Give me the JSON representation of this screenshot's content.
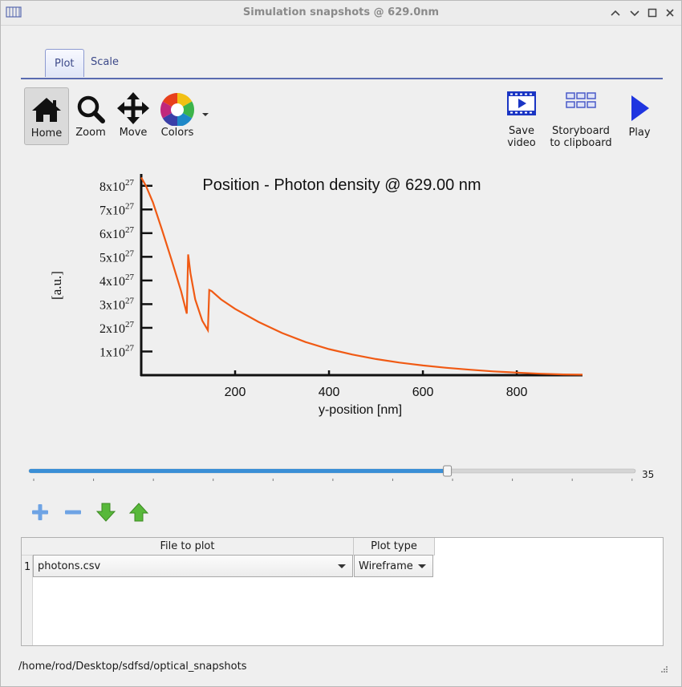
{
  "window": {
    "title": "Simulation snapshots @ 629.0nm"
  },
  "tabs": [
    {
      "label": "Plot",
      "active": true
    },
    {
      "label": "Scale",
      "active": false
    }
  ],
  "toolbar": {
    "home": "Home",
    "zoom": "Zoom",
    "move": "Move",
    "colors": "Colors",
    "save_video": [
      "Save",
      "video"
    ],
    "storyboard": [
      "Storyboard",
      "to clipboard"
    ],
    "play": "Play"
  },
  "colors": {
    "accent": "#5a6bb0",
    "curve": "#f05a14",
    "slider": "#3a8fd6"
  },
  "chart_data": {
    "type": "line",
    "title": "Position - Photon density @ 629.00 nm",
    "xlabel": "y-position [nm]",
    "ylabel": "[a.u.]",
    "xlim": [
      0,
      940
    ],
    "ylim": [
      0,
      8.5e+27
    ],
    "xticks": [
      200,
      400,
      600,
      800
    ],
    "yticks": [
      {
        "value": 1e+27,
        "mant": "1",
        "exp": "27"
      },
      {
        "value": 2e+27,
        "mant": "2",
        "exp": "27"
      },
      {
        "value": 3e+27,
        "mant": "3",
        "exp": "27"
      },
      {
        "value": 4e+27,
        "mant": "4",
        "exp": "27"
      },
      {
        "value": 5e+27,
        "mant": "5",
        "exp": "27"
      },
      {
        "value": 6e+27,
        "mant": "6",
        "exp": "27"
      },
      {
        "value": 7e+27,
        "mant": "7",
        "exp": "27"
      },
      {
        "value": 8e+27,
        "mant": "8",
        "exp": "27"
      }
    ],
    "tick_x_label": "x10",
    "series": [
      {
        "x": [
          0,
          10,
          25,
          45,
          65,
          85,
          97,
          100,
          105,
          115,
          130,
          142,
          145,
          150,
          170,
          200,
          250,
          300,
          350,
          400,
          450,
          500,
          550,
          600,
          650,
          700,
          750,
          800,
          850,
          900,
          940
        ],
        "y": [
          8.35e+27,
          8e+27,
          7.3e+27,
          6.1e+27,
          4.85e+27,
          3.55e+27,
          2.6e+27,
          5.1e+27,
          4.3e+27,
          3.2e+27,
          2.3e+27,
          1.9e+27,
          3.6e+27,
          3.55e+27,
          3.2e+27,
          2.8e+27,
          2.25e+27,
          1.78e+27,
          1.4e+27,
          1.1e+27,
          8.7e+26,
          6.8e+26,
          5.3e+26,
          4.1e+26,
          3.1e+26,
          2.3e+26,
          1.6e+26,
          1.1e+26,
          6e+25,
          3e+25,
          2e+25
        ]
      }
    ]
  },
  "slider": {
    "value": "35",
    "fraction": 0.69,
    "ticks": 11
  },
  "table": {
    "headers": [
      "File to plot",
      "Plot type"
    ],
    "rows": [
      {
        "num": "1",
        "file": "photons.csv",
        "plot_type": "Wireframe"
      }
    ]
  },
  "status": {
    "path": "/home/rod/Desktop/sdfsd/optical_snapshots"
  }
}
